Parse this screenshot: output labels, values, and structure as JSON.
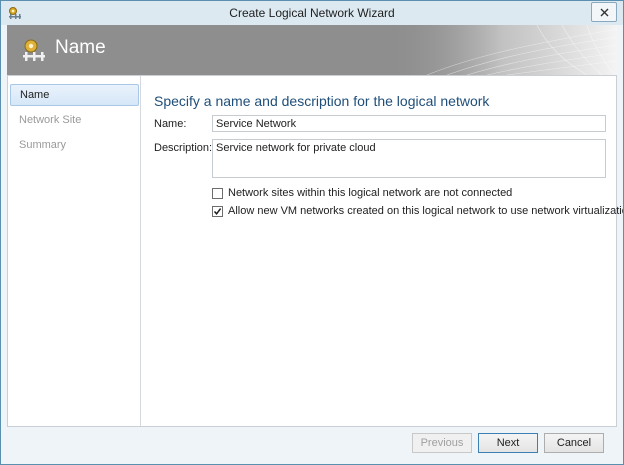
{
  "window": {
    "title": "Create Logical Network Wizard"
  },
  "header": {
    "title": "Name"
  },
  "nav": {
    "items": [
      {
        "label": "Name",
        "active": true
      },
      {
        "label": "Network Site",
        "active": false
      },
      {
        "label": "Summary",
        "active": false
      }
    ]
  },
  "form": {
    "heading": "Specify a name and description for the logical network",
    "name_label": "Name:",
    "name_value": "Service Network",
    "description_label": "Description:",
    "description_value": "Service network for private cloud",
    "checkboxes": [
      {
        "label": "Network sites within this logical network are not connected",
        "checked": false
      },
      {
        "label": "Allow new VM networks created on this logical network to use network virtualization",
        "checked": true
      }
    ]
  },
  "footer": {
    "previous_label": "Previous",
    "next_label": "Next",
    "cancel_label": "Cancel"
  },
  "icons": {
    "app": "network-gear-icon",
    "close": "close-icon",
    "header": "network-gear-icon"
  }
}
